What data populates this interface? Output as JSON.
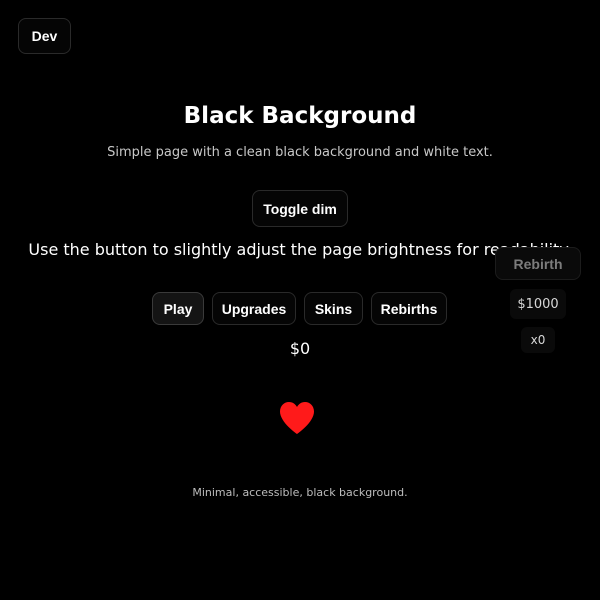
{
  "dev_button": {
    "label": "Dev"
  },
  "header": {
    "title": "Black Background",
    "subtitle": "Simple page with a clean black background and white text."
  },
  "toggle_button": {
    "label": "Toggle dim"
  },
  "hint": "Use the button to slightly adjust the page brightness for readability.",
  "tabs": [
    {
      "label": "Play",
      "active": true
    },
    {
      "label": "Upgrades",
      "active": false
    },
    {
      "label": "Skins",
      "active": false
    },
    {
      "label": "Rebirths",
      "active": false
    }
  ],
  "money": "$0",
  "rebirth_panel": {
    "button_label": "Rebirth",
    "cost": "$1000",
    "count": "x0"
  },
  "clicker": {
    "icon": "heart-icon",
    "color": "#ff1a1a"
  },
  "footer": "Minimal, accessible, black background.",
  "colors": {
    "background": "#000000",
    "text": "#ffffff",
    "muted": "#c8c8c8",
    "border": "#2a2a2a",
    "accent": "#ff1a1a"
  }
}
